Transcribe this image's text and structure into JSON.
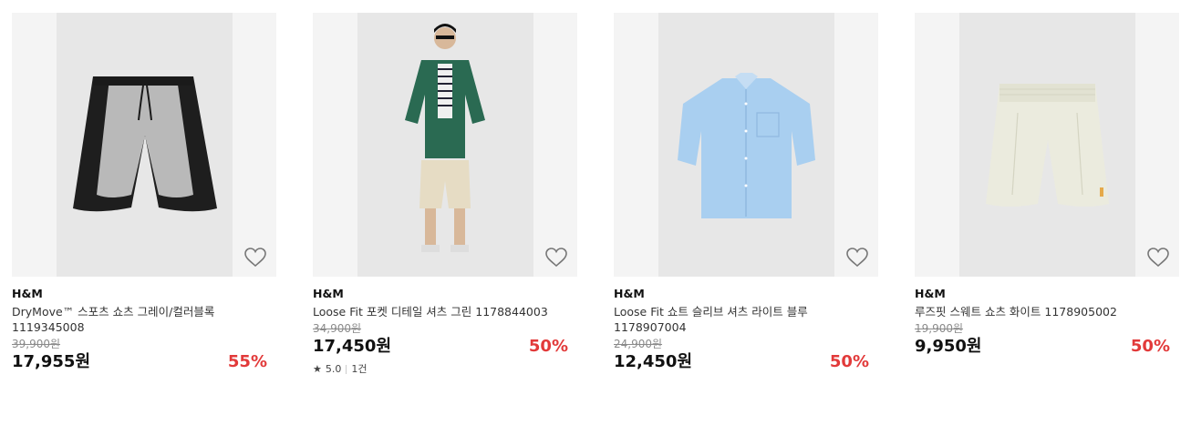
{
  "products": [
    {
      "brand": "H&M",
      "name": "DryMove™ 스포츠 쇼츠 그레이/컬러블록 1119345008",
      "original_price": "39,900원",
      "sale_price": "17,955원",
      "discount": "55%",
      "image_icon": "sports-shorts-image"
    },
    {
      "brand": "H&M",
      "name": "Loose Fit 포켓 디테일 셔츠 그린 1178844003",
      "original_price": "34,900원",
      "sale_price": "17,450원",
      "discount": "50%",
      "rating": "5.0",
      "review_count": "1건",
      "image_icon": "model-shirt-image"
    },
    {
      "brand": "H&M",
      "name": "Loose Fit 쇼트 슬리브 셔츠 라이트 블루 1178907004",
      "original_price": "24,900원",
      "sale_price": "12,450원",
      "discount": "50%",
      "image_icon": "blue-shirt-image"
    },
    {
      "brand": "H&M",
      "name": "루즈핏 스웨트 쇼츠 화이트 1178905002",
      "original_price": "19,900원",
      "sale_price": "9,950원",
      "discount": "50%",
      "image_icon": "sweat-shorts-image"
    }
  ],
  "colors": {
    "discount": "#e23a3a",
    "image_bg": "#f4f4f4",
    "image_inner_bg": "#e7e7e7"
  }
}
